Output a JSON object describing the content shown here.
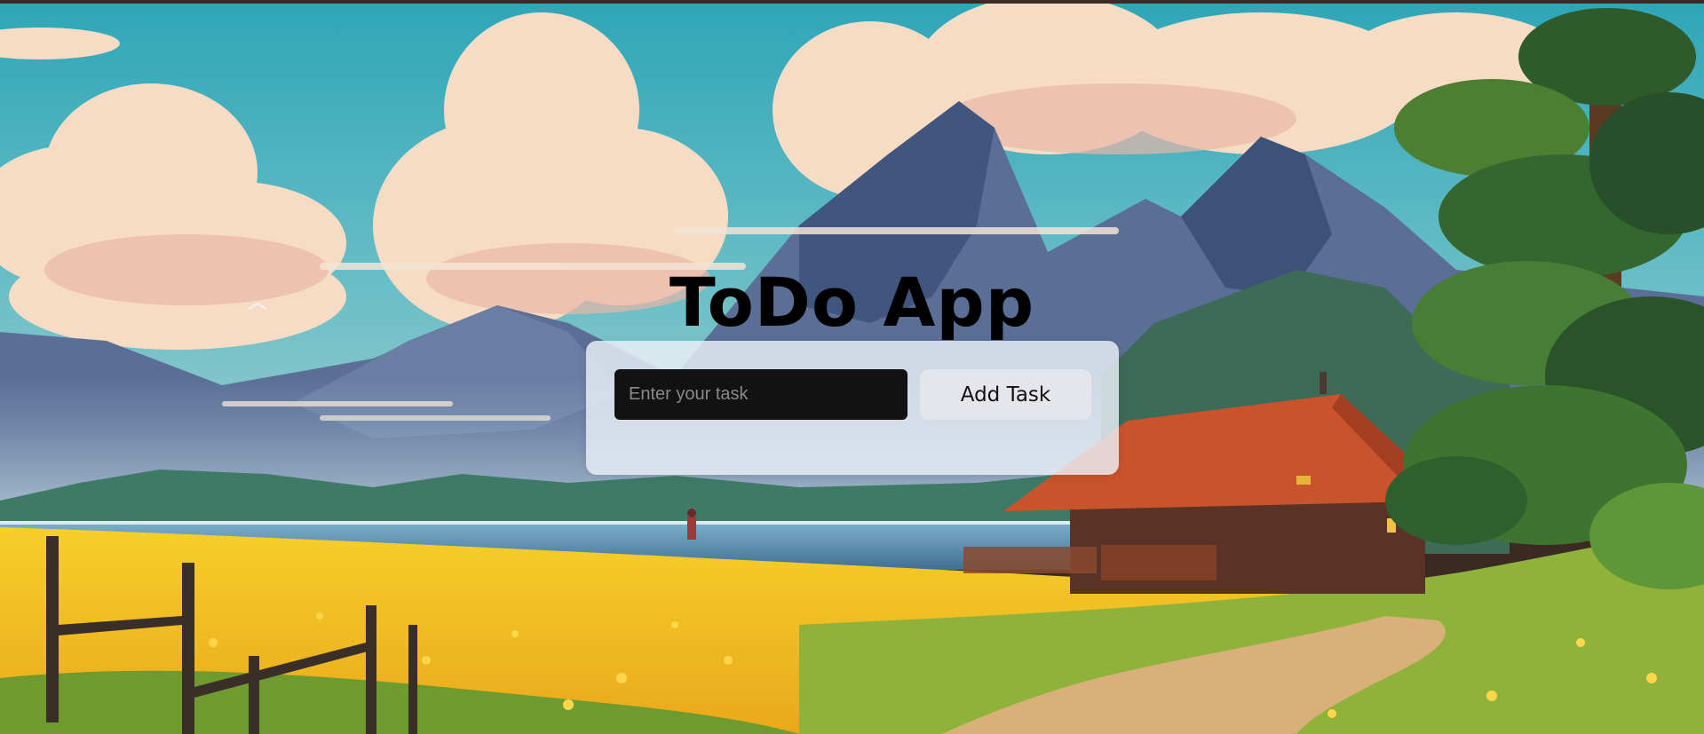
{
  "app": {
    "title": "ToDo App"
  },
  "form": {
    "input_placeholder": "Enter your task",
    "input_value": "",
    "add_button_label": "Add Task"
  },
  "background": {
    "scene": "landscape-illustration",
    "colors": {
      "sky": "#3fb0c2",
      "cloud": "#f6d9c2",
      "mountain": "#41587f",
      "lake": "#4c7fa2",
      "meadow": "#f4c51f",
      "grass": "#7faf3a",
      "roof": "#d0542a",
      "tree": "#2d5a2a"
    }
  }
}
